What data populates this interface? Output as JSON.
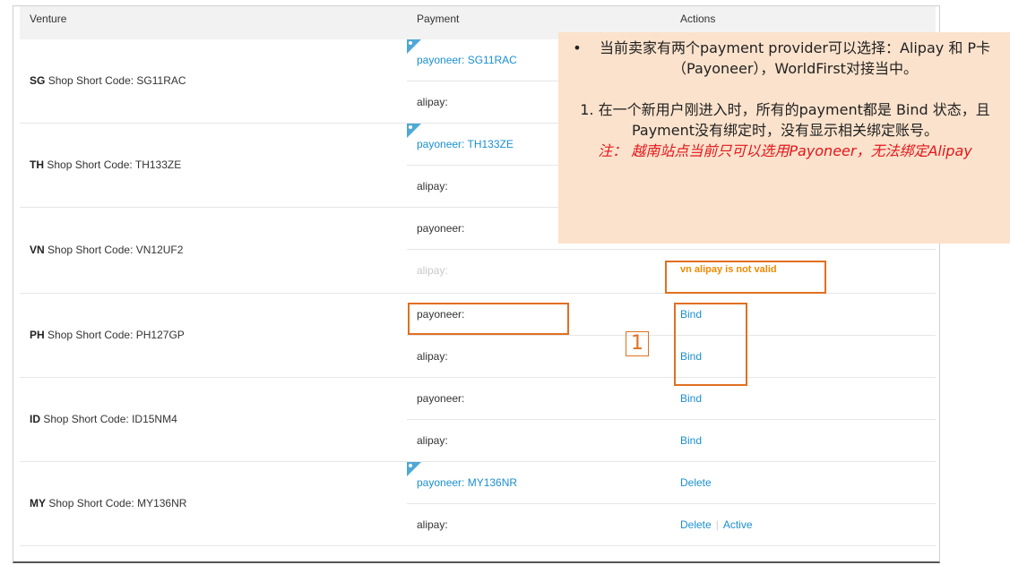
{
  "table": {
    "headers": {
      "venture": "Venture",
      "payment": "Payment",
      "actions": "Actions"
    },
    "rows": [
      {
        "code": "SG",
        "label": "Shop Short Code: SG11RAC",
        "payments": [
          {
            "text": "payoneer: SG11RAC",
            "state": "linked",
            "actions": []
          },
          {
            "text": "alipay:",
            "state": "normal",
            "actions": []
          }
        ]
      },
      {
        "code": "TH",
        "label": "Shop Short Code: TH133ZE",
        "payments": [
          {
            "text": "payoneer: TH133ZE",
            "state": "linked",
            "actions": []
          },
          {
            "text": "alipay:",
            "state": "normal",
            "actions": []
          }
        ]
      },
      {
        "code": "VN",
        "label": "Shop Short Code: VN12UF2",
        "payments": [
          {
            "text": "payoneer:",
            "state": "normal",
            "actions": []
          },
          {
            "text": "alipay:",
            "state": "disabled",
            "actions": [],
            "warning": "vn alipay is not valid"
          }
        ]
      },
      {
        "code": "PH",
        "label": "Shop Short Code: PH127GP",
        "payments": [
          {
            "text": "payoneer:",
            "state": "normal",
            "actions": [
              "Bind"
            ]
          },
          {
            "text": "alipay:",
            "state": "normal",
            "actions": [
              "Bind"
            ]
          }
        ]
      },
      {
        "code": "ID",
        "label": "Shop Short Code: ID15NM4",
        "payments": [
          {
            "text": "payoneer:",
            "state": "normal",
            "actions": [
              "Bind"
            ]
          },
          {
            "text": "alipay:",
            "state": "normal",
            "actions": [
              "Bind"
            ]
          }
        ]
      },
      {
        "code": "MY",
        "label": "Shop Short Code: MY136NR",
        "payments": [
          {
            "text": "payoneer: MY136NR",
            "state": "linked",
            "actions": [
              "Delete"
            ]
          },
          {
            "text": "alipay:",
            "state": "normal",
            "actions": [
              "Delete",
              "Active"
            ]
          }
        ]
      }
    ]
  },
  "annotation": {
    "number": "1",
    "bullet": "•",
    "line1": "当前卖家有两个payment provider可以选择：Alipay 和 P卡（Payoneer），WorldFirst对接当中。",
    "line2": "1. 在一个新用户刚进入时，所有的payment都是 Bind 状态，且Payment没有绑定时，没有显示相关绑定账号。",
    "line3": "注： 越南站点当前只可以选用Payoneer，无法绑定Alipay"
  },
  "colors": {
    "link": "#1a8fd0",
    "warning": "#f08a00",
    "highlight": "#e07020",
    "note_bg": "#fbe2cc",
    "note_red": "#e3161b"
  }
}
